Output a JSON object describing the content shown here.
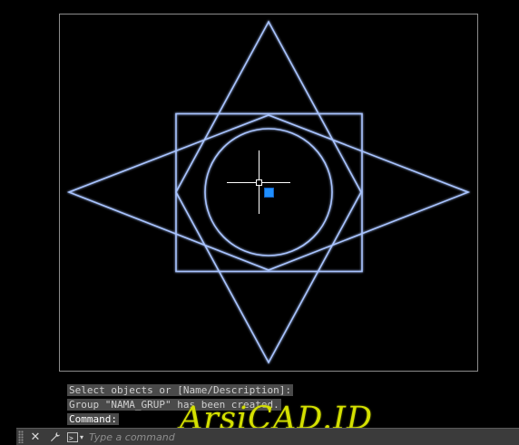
{
  "colors": {
    "background": "#000000",
    "geometry": "#a9c4ff",
    "geometry_glow": "#3f6fe0",
    "viewport_border": "#8c8c8c",
    "grip": "#1f8fff",
    "crosshair": "#ffffff",
    "history_bg": "#4a4a4a",
    "cmdbar_bg": "#3b3b3b",
    "watermark": "#d4e000"
  },
  "drawing": {
    "shapes": [
      "viewport-frame",
      "star-diamond-horizontal",
      "star-diamond-vertical",
      "rectangle",
      "hexagon",
      "circle"
    ],
    "cursor": "crosshair-pickbox",
    "grip_icon": "selection-grip"
  },
  "command_history": [
    "Select objects or [Name/Description]:",
    "Group \"NAMA_GRUP\" has been created.",
    "Command:"
  ],
  "watermark": "ArsiCAD.ID",
  "command_bar": {
    "close_icon": "close-icon",
    "customize_icon": "wrench-icon",
    "prompt_icon": "command-prompt-icon",
    "prompt_glyph": ">_",
    "placeholder": "Type a command"
  }
}
